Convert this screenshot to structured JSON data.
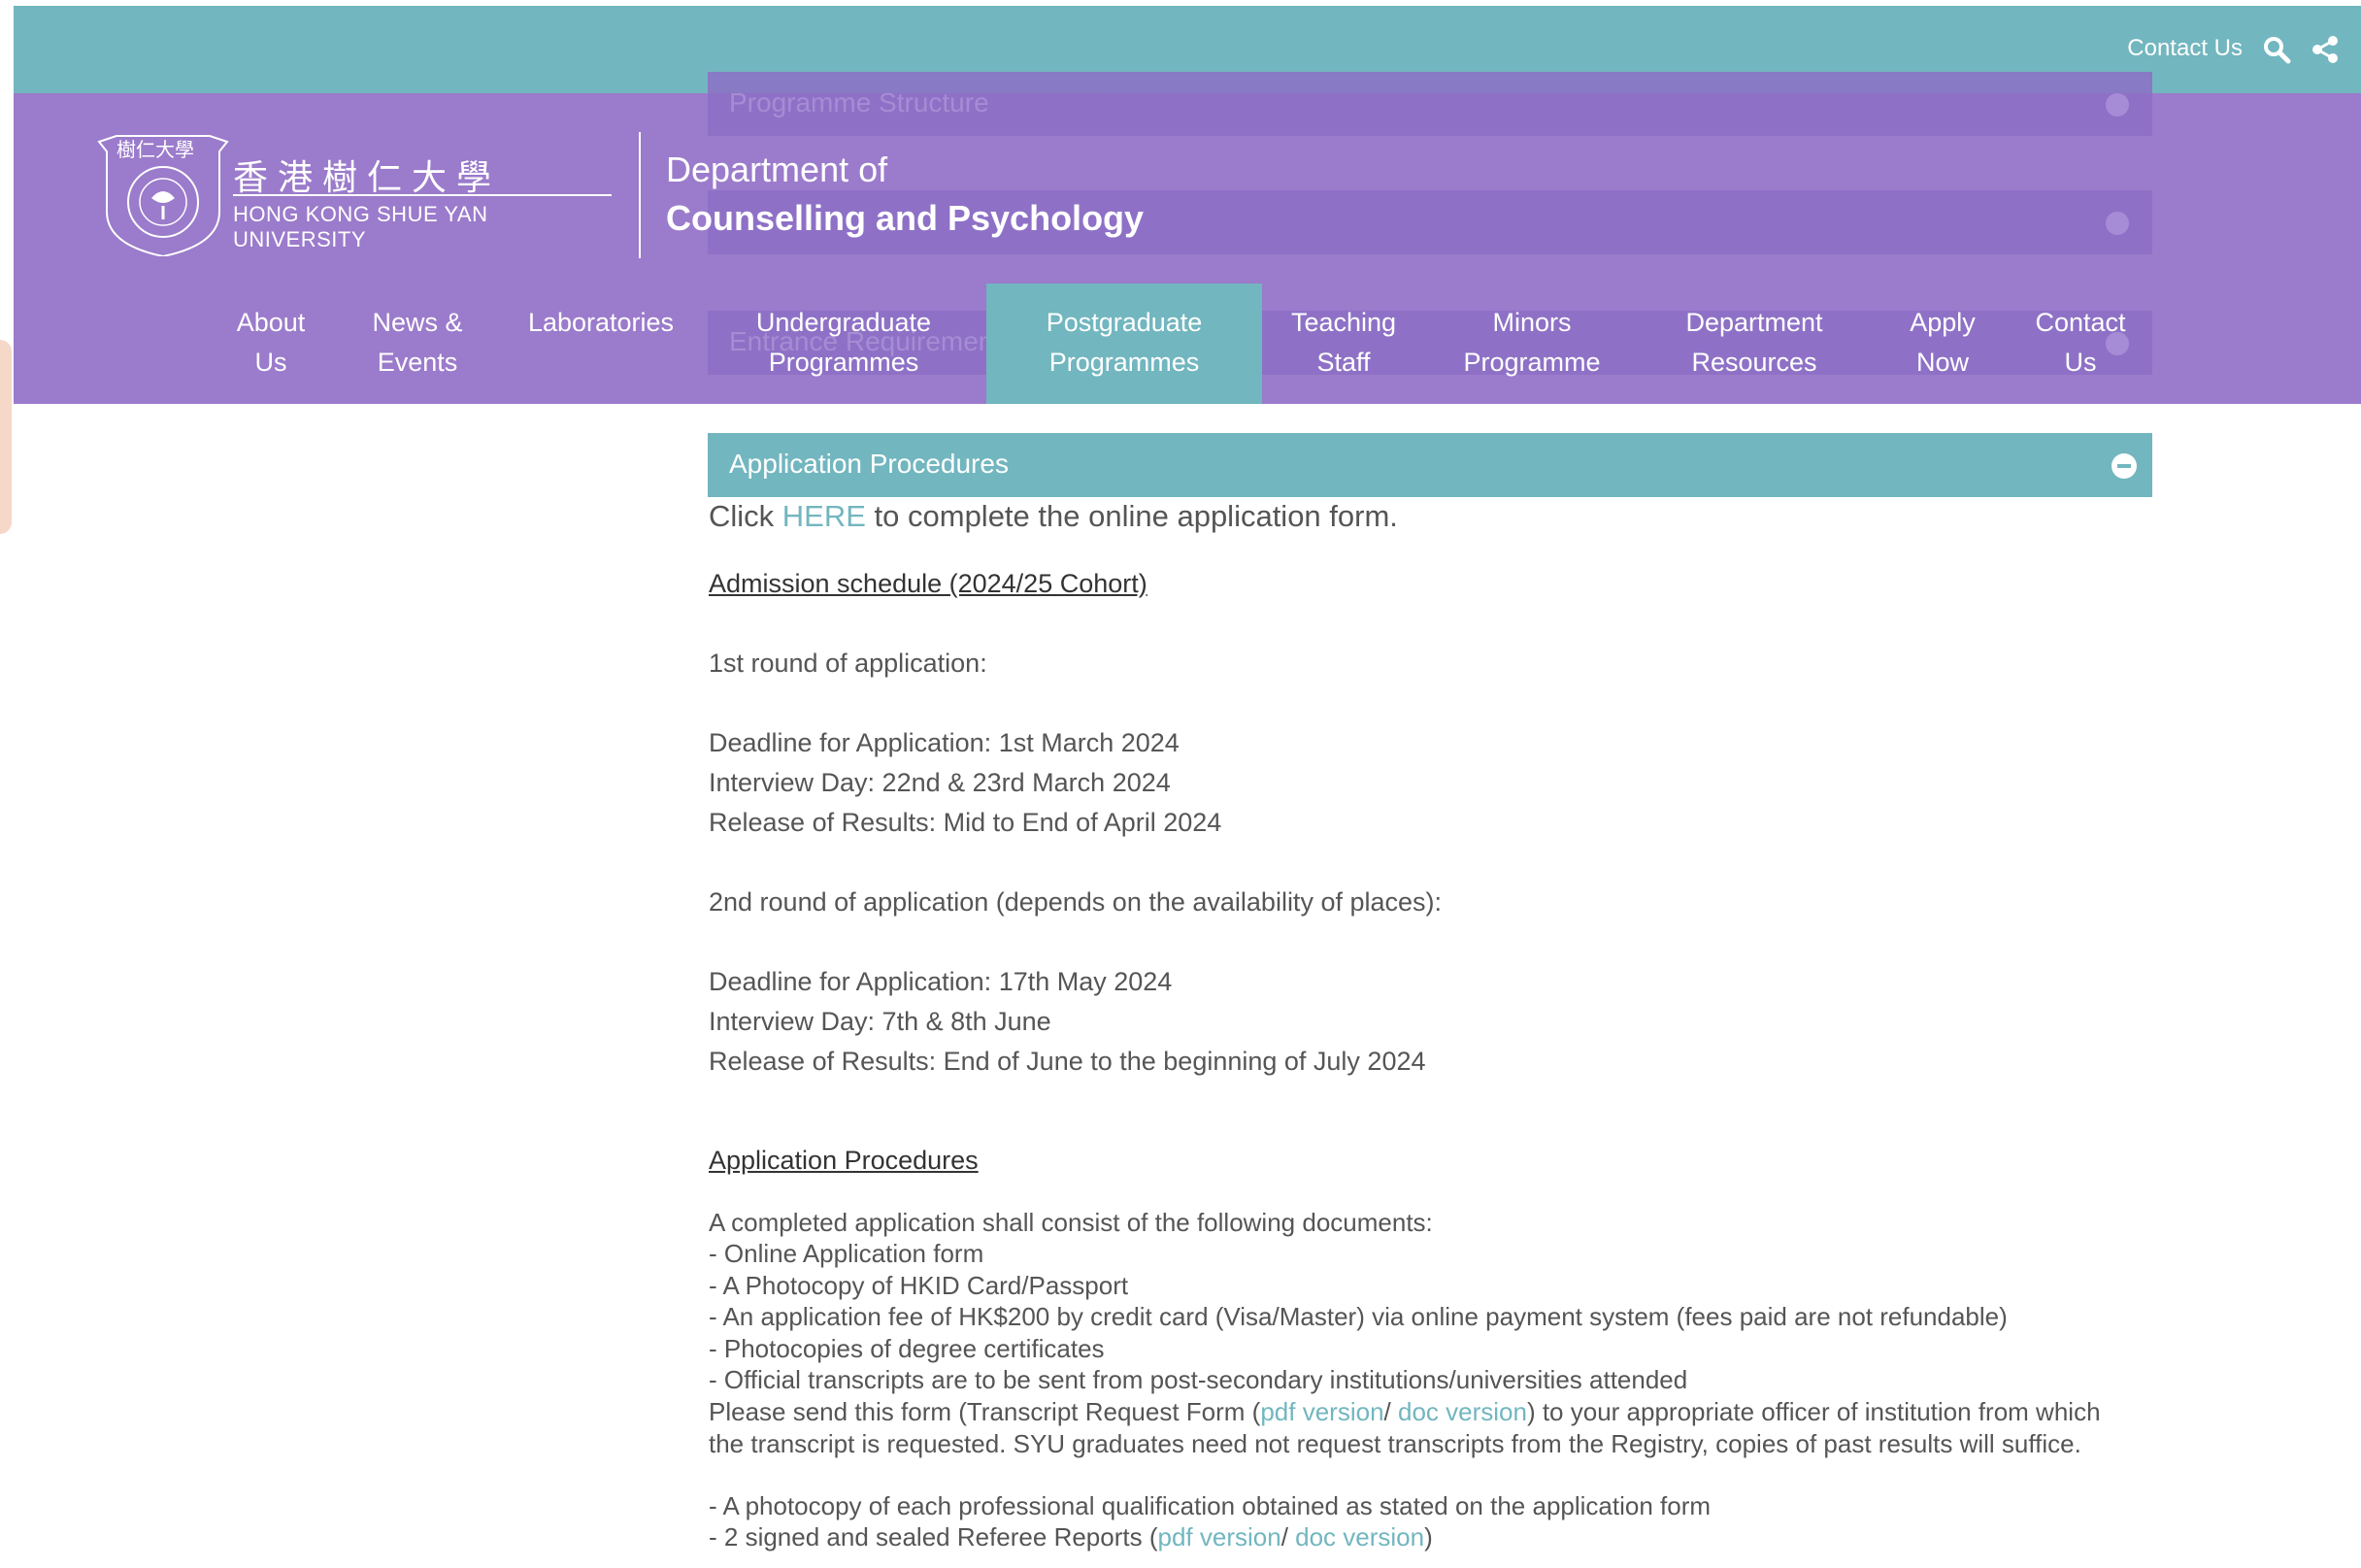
{
  "topbar": {
    "contact_label": "Contact Us",
    "icons": [
      "search-icon",
      "share-icon"
    ]
  },
  "header": {
    "logo_cn": "香港樹仁大學",
    "logo_crest_text": "樹仁大學",
    "logo_en": "HONG KONG SHUE YAN UNIVERSITY",
    "dept_line1": "Department of",
    "dept_line2": "Counselling and Psychology"
  },
  "ghost_sections": [
    {
      "label": "Programme Structure"
    },
    {
      "label": ""
    },
    {
      "label": "Entrance Requirement"
    }
  ],
  "nav": [
    {
      "line1": "About",
      "line2": "Us"
    },
    {
      "line1": "News &",
      "line2": "Events"
    },
    {
      "line1": "Laboratories",
      "line2": ""
    },
    {
      "line1": "Undergraduate",
      "line2": "Programmes"
    },
    {
      "line1": "Postgraduate",
      "line2": "Programmes"
    },
    {
      "line1": "Teaching",
      "line2": "Staff"
    },
    {
      "line1": "Minors",
      "line2": "Programme"
    },
    {
      "line1": "Department",
      "line2": "Resources"
    },
    {
      "line1": "Apply",
      "line2": "Now"
    },
    {
      "line1": "Contact",
      "line2": "Us"
    }
  ],
  "accordion": {
    "title": "Application Procedures",
    "click_pre": "Click ",
    "click_link": "HERE",
    "click_post": " to complete the online application form.",
    "schedule_heading": "Admission schedule (2024/25 Cohort)",
    "round1_title": "1st round of application:",
    "round1_deadline": "Deadline for Application: 1st March 2024",
    "round1_interview": "Interview Day: 22nd & 23rd March 2024",
    "round1_results": "Release of Results: Mid to End of April 2024",
    "round2_title": "2nd round of application (depends on the availability of places):",
    "round2_deadline": "Deadline for Application: 17th May 2024",
    "round2_interview": "Interview Day: 7th & 8th June",
    "round2_results": "Release of Results: End of June to the beginning of July 2024",
    "procedures_heading": "Application Procedures",
    "docs_intro": "A completed application shall consist of the following documents:",
    "doc1": "- Online Application form",
    "doc2": "- A Photocopy of HKID Card/Passport",
    "doc3": "- An application fee of HK$200 by credit card (Visa/Master) via online payment system (fees paid are not refundable)",
    "doc4": "- Photocopies of degree certificates",
    "doc5": "- Official transcripts are to be sent from post-secondary institutions/universities attended",
    "transcript_pre": "Please send this form (Transcript Request Form (",
    "transcript_pdf": "pdf version",
    "transcript_sep": "/ ",
    "transcript_doc": "doc version",
    "transcript_post": ") to your appropriate officer of institution from which the transcript is requested. SYU graduates need not request transcripts from the Registry, copies of past results will suffice.",
    "doc6": "- A photocopy of each professional qualification obtained as stated on the application form",
    "doc7_pre": "- 2 signed and sealed Referee Reports (",
    "doc7_pdf": "pdf version",
    "doc7_sep": "/ ",
    "doc7_doc": "doc version",
    "doc7_post": ")"
  },
  "colors": {
    "teal": "#72b6bf",
    "purple": "#9b7bcb"
  }
}
